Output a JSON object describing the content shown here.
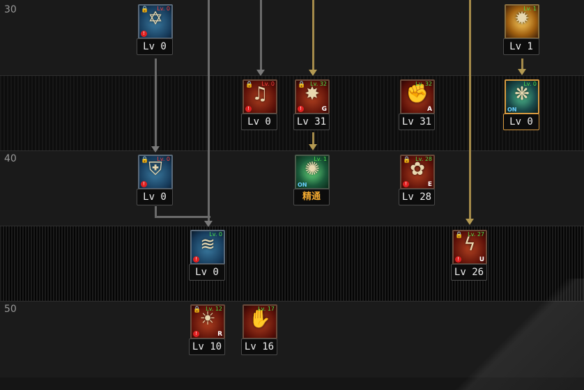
{
  "level_markers": [
    "30",
    "40",
    "50"
  ],
  "skills": [
    {
      "level_text": "Lv 0",
      "req": "Lv. 0",
      "icon": "hexagram-icon",
      "glyph": "✡",
      "color": "blue",
      "locked": true,
      "warn": true
    },
    {
      "level_text": "Lv 1",
      "req": "Lv. 1",
      "icon": "golden-burst-icon",
      "glyph": "✹",
      "color": "gold",
      "locked": false,
      "warn": false
    },
    {
      "level_text": "Lv 0",
      "req": "Lv. 0",
      "icon": "music-notes-icon",
      "glyph": "♫",
      "color": "red",
      "locked": true,
      "warn": true
    },
    {
      "level_text": "Lv 31",
      "req": "Lv. 32",
      "icon": "flash-burst-icon",
      "glyph": "✸",
      "color": "red",
      "locked": true,
      "warn": true,
      "corner": "G"
    },
    {
      "level_text": "Lv 31",
      "req": "Lv. 32",
      "icon": "fist-strike-icon",
      "glyph": "✊",
      "color": "red",
      "locked": false,
      "warn": false,
      "corner": "A"
    },
    {
      "level_text": "Lv 0",
      "req": "Lv. 0",
      "icon": "green-snowflake-icon",
      "glyph": "❋",
      "color": "teal",
      "locked": false,
      "warn": false,
      "on": "ON",
      "selected": true
    },
    {
      "level_text": "Lv 0",
      "req": "Lv. 0",
      "icon": "shield-sword-icon",
      "glyph": "⛨",
      "color": "blue",
      "locked": true,
      "warn": true
    },
    {
      "level_text": "精通",
      "req": "Lv. 1",
      "icon": "green-flash-icon",
      "glyph": "✺",
      "color": "green",
      "locked": false,
      "warn": false,
      "on": "ON",
      "mastery": true
    },
    {
      "level_text": "Lv 28",
      "req": "Lv. 28",
      "icon": "gear-sun-icon",
      "glyph": "✿",
      "color": "red",
      "locked": true,
      "warn": true,
      "corner": "E"
    },
    {
      "level_text": "Lv 0",
      "req": "Lv. 0",
      "icon": "wind-slash-icon",
      "glyph": "≋",
      "color": "blue",
      "locked": false,
      "warn": true
    },
    {
      "level_text": "Lv 26",
      "req": "Lv. 27",
      "icon": "lightning-strike-icon",
      "glyph": "ϟ",
      "color": "red",
      "locked": true,
      "warn": true,
      "corner": "U"
    },
    {
      "level_text": "Lv 10",
      "req": "Lv. 12",
      "icon": "flame-eye-icon",
      "glyph": "☀",
      "color": "red",
      "locked": true,
      "warn": true,
      "corner": "R"
    },
    {
      "level_text": "Lv 16",
      "req": "Lv. 17",
      "icon": "green-fist-icon",
      "glyph": "✋",
      "color": "red",
      "locked": false,
      "warn": false
    }
  ]
}
